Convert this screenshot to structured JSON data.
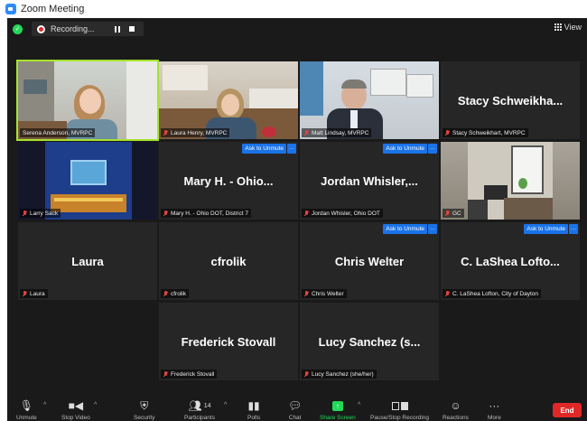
{
  "window": {
    "title": "Zoom Meeting"
  },
  "topbar": {
    "recording_label": "Recording...",
    "view_label": "View"
  },
  "tiles": [
    {
      "name": "Serena Anderson, MVRPC"
    },
    {
      "name": "Laura Henry, MVRPC"
    },
    {
      "name": "Matt Lindsay, MVRPC"
    },
    {
      "display": "Stacy  Schweikha...",
      "name": "Stacy Schweikhart, MVRPC"
    },
    {
      "name": "Larry Sack"
    },
    {
      "display": "Mary H. - Ohio...",
      "name": "Mary H. - Ohio DOT, District 7"
    },
    {
      "display": "Jordan  Whisler,...",
      "name": "Jordan Whisler, Ohio DOT"
    },
    {
      "name": "GC"
    },
    {
      "display": "Laura",
      "name": "Laura"
    },
    {
      "display": "cfrolik",
      "name": "cfrolik"
    },
    {
      "display": "Chris Welter",
      "name": "Chris Welter"
    },
    {
      "display": "C. LaShea  Lofto...",
      "name": "C. LaShea Lofton, City of Dayton"
    },
    {
      "display": "Frederick Stovall",
      "name": "Frederick Stovall"
    },
    {
      "display": "Lucy  Sanchez (s...",
      "name": "Lucy Sanchez (she/her)"
    }
  ],
  "ask_to_unmute": "Ask to Unmute",
  "more_glyph": "···",
  "toolbar": {
    "unmute": "Unmute",
    "stop_video": "Stop Video",
    "security": "Security",
    "participants": "Participants",
    "participant_count": "14",
    "polls": "Polls",
    "chat": "Chat",
    "share_screen": "Share Screen",
    "pause_recording": "Pause/Stop Recording",
    "reactions": "Reactions",
    "more": "More",
    "end": "End"
  },
  "colors": {
    "active_speaker": "#a6e22e",
    "ask_unmute": "#1a73e8",
    "end": "#e02828",
    "share": "#23d959"
  }
}
